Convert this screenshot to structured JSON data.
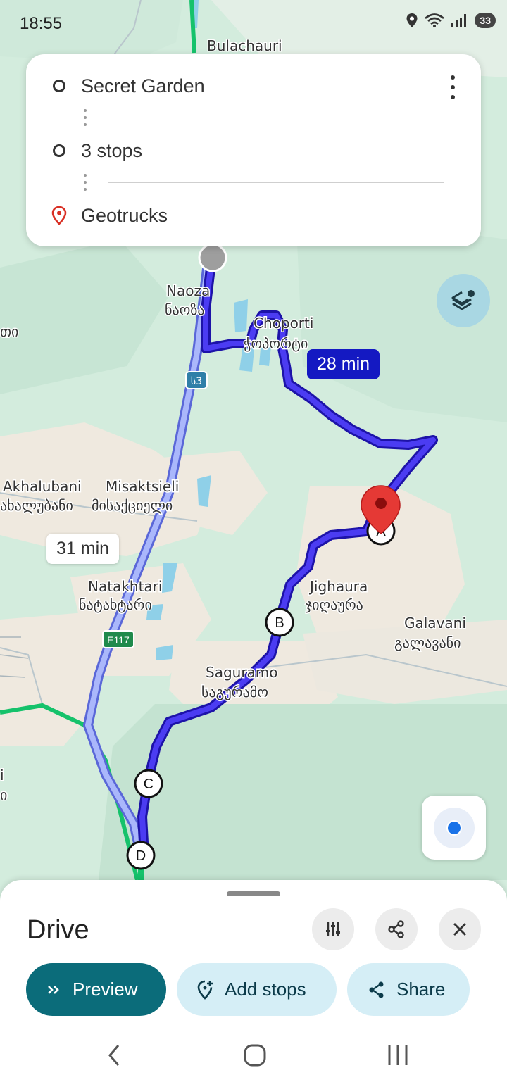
{
  "status": {
    "time": "18:55",
    "battery": "33"
  },
  "route_card": {
    "origin": "Secret Garden",
    "stops": "3 stops",
    "destination": "Geotrucks"
  },
  "map": {
    "labels": {
      "bulachauri": "Bulachauri",
      "naoza_en": "Naoza",
      "naoza_ka": "ნაოზა",
      "choporti_en": "Choporti",
      "choporti_ka": "ჭოპორტი",
      "akhalubani_en": "Akhalubani",
      "akhalubani_ka": "ახალუბანი",
      "misaktsieli_en": "Misaktsieli",
      "misaktsieli_ka": "მისაქციელი",
      "natakhtari_en": "Natakhtari",
      "natakhtari_ka": "ნატახტარი",
      "jighaura_en": "Jighaura",
      "jighaura_ka": "ჯიღაურა",
      "galavani_en": "Galavani",
      "galavani_ka": "გალავანი",
      "saguramo_en": "Saguramo",
      "saguramo_ka": "საგურამო",
      "edge_left_1": "თი",
      "edge_left_2": "i",
      "edge_left_3": "ი"
    },
    "road_shields": {
      "s3": "ს3",
      "e117": "E117"
    },
    "markers": {
      "a": "A",
      "b": "B",
      "c": "C",
      "d": "D"
    },
    "route_time_selected": "28 min",
    "route_time_alt": "31 min",
    "colors": {
      "route_selected": "#2a1fd4",
      "route_alt": "#8d9cf2",
      "pin": "#e53935",
      "highway": "#15c26b"
    }
  },
  "sheet": {
    "title": "Drive",
    "preview_label": "Preview",
    "add_stops_label": "Add stops",
    "share_label": "Share"
  }
}
